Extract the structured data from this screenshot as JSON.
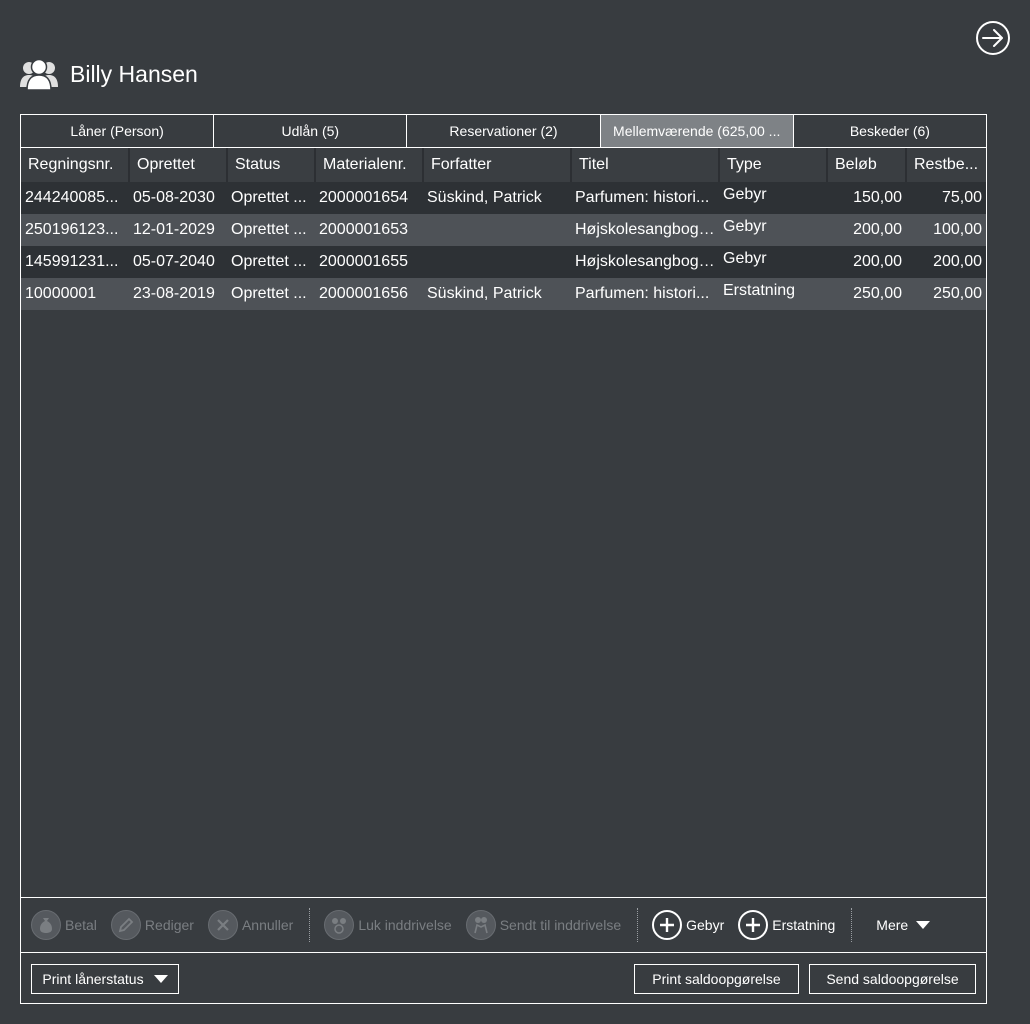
{
  "header": {
    "user_name": "Billy Hansen"
  },
  "tabs": [
    {
      "label": "Låner (Person)",
      "active": false
    },
    {
      "label": "Udlån (5)",
      "active": false
    },
    {
      "label": "Reservationer (2)",
      "active": false
    },
    {
      "label": "Mellemværende (625,00 ...",
      "active": true
    },
    {
      "label": "Beskeder (6)",
      "active": false
    }
  ],
  "table": {
    "columns": [
      "Regningsnr.",
      "Oprettet",
      "Status",
      "Materialenr.",
      "Forfatter",
      "Titel",
      "Type",
      "Beløb",
      "Restbe..."
    ],
    "rows": [
      [
        "244240085...",
        "05-08-2030",
        "Oprettet ...",
        "2000001654",
        "Süskind, Patrick",
        "Parfumen: histori...",
        "Gebyr",
        "150,00",
        "75,00"
      ],
      [
        "250196123...",
        "12-01-2029",
        "Oprettet ...",
        "2000001653",
        "",
        "Højskolesangbogen",
        "Gebyr",
        "200,00",
        "100,00"
      ],
      [
        "145991231...",
        "05-07-2040",
        "Oprettet ...",
        "2000001655",
        "",
        "Højskolesangbogen",
        "Gebyr",
        "200,00",
        "200,00"
      ],
      [
        "10000001",
        "23-08-2019",
        "Oprettet ...",
        "2000001656",
        "Süskind, Patrick",
        "Parfumen: histori...",
        "Erstatning",
        "250,00",
        "250,00"
      ]
    ]
  },
  "actions": {
    "betal": "Betal",
    "rediger": "Rediger",
    "annuller": "Annuller",
    "luk_inddrivelse": "Luk inddrivelse",
    "sendt_til_inddrivelse": "Sendt til inddrivelse",
    "gebyr": "Gebyr",
    "erstatning": "Erstatning",
    "mere": "Mere"
  },
  "footer": {
    "print_status": "Print lånerstatus",
    "print_saldo": "Print saldoopgørelse",
    "send_saldo": "Send saldoopgørelse"
  }
}
